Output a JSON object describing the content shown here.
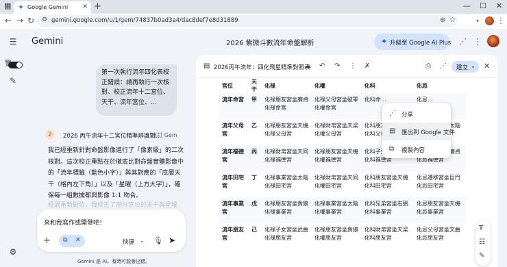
{
  "browser": {
    "tab_title": "Google Gemini",
    "url": "gemini.google.com/u/1/gem/74837b0ad3a4/dac8def7e8d31889"
  },
  "app": {
    "brand": "Gemini",
    "document_title": "2026 紫微斗數流年命盤解析",
    "upgrade_label": "升級至 Google AI Plus"
  },
  "chat": {
    "user_message": "第一次執行流年四化表校正錯誤：請再執行一次核對、校正流年十二宮位、天干、流年宮位、…",
    "step_number": "2",
    "step_title": "2026 丙午流年十二宮位精準辨識對…",
    "step_source": "• 自訂 Gem",
    "answer": "我已經重新針對命盤影像進行了「像素級」的二次核對。這次校正重點在於徹底比對命盤實體影像中的「流年標籤（藍色小字）」與其對應的「底層天干（格內左下角）」以及「星曜（上方大字）」，確保每一組數據都與影像 1:1 吻合。",
    "answer_faded": "經過重新對位，我修正了部分宮位的天干與星曜",
    "input_text": "來和我寫作或開發吧！",
    "mode_label": "快捷",
    "disclaimer": "Gemini 是 AI，有時可能會出錯。"
  },
  "canvas": {
    "title": "2026丙午流年：四化飛星精準對照表",
    "create_label": "建立",
    "headers": [
      "宮位",
      "天干",
      "化祿",
      "化權",
      "化科",
      "化忌"
    ],
    "rows": [
      [
        "流年命宮",
        "甲",
        "化祿朋友宮坐廉貞化祿命宮",
        "化祿父母宮坐破軍化權命宮",
        "化科命…",
        "化忌…"
      ],
      [
        "流年父母宮",
        "乙",
        "化祿朋友宮坐天機化祿父母宮",
        "化祿財帛宮坐天梁化權父母宮",
        "化科朋友宮坐紫微化科父母宮",
        "化忌福德宮坐太陰化忌父母宮"
      ],
      [
        "流年福德宮",
        "丙",
        "化祿財帛宮坐天同化祿福德宮",
        "化祿朋友宮坐天機化權福德宮",
        "化科子女宮坐文昌化科福德宮",
        "化忌朋友宮坐廉貞化忌福德宮"
      ],
      [
        "流年田宅宮",
        "丁",
        "化祿事業宮坐太陰化祿田宅宮",
        "化祿財帛宮坐天同化權田宅宮",
        "化科朋友宮坐天機化科田宅宮",
        "化忌遷移宮坐巨門化忌田宅宮"
      ],
      [
        "流年事業宮",
        "戊",
        "化祿朋友宮坐貪狼化祿事業宮",
        "化祿事業宮坐太陰化權事業宮",
        "化科兄弟宮坐右弼化科事業宮",
        "化忌朋友宮坐天機化忌事業宮"
      ],
      [
        "流年朋友宮",
        "己",
        "化祿子女宮坐武曲化祿朋友宮",
        "化祿朋友宮坐貪狼化權朋友宮",
        "化科財帛宮坐天梁化科朋友宮",
        "化忌父母宮坐文曲化忌朋友宮"
      ]
    ],
    "menu": [
      "分享",
      "匯出到 Google 文件",
      "複製內容"
    ]
  }
}
